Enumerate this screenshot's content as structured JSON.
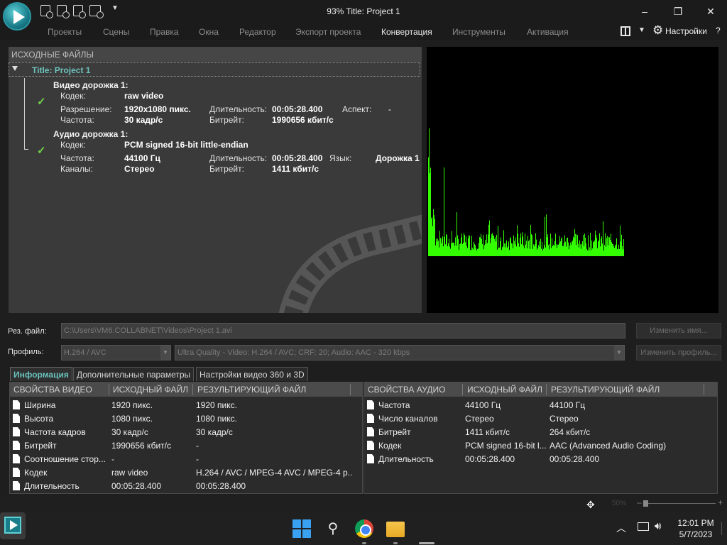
{
  "window": {
    "title": "93% Title: Project 1",
    "minimize": "–",
    "maximize": "❐",
    "close": "✕"
  },
  "menu": {
    "items": [
      "Проекты",
      "Сцены",
      "Правка",
      "Окна",
      "Редактор",
      "Экспорт проекта",
      "Конвертация",
      "Инструменты",
      "Активация"
    ],
    "active": "Конвертация",
    "settings_label": "Настройки",
    "help": "?"
  },
  "source": {
    "header": "ИСХОДНЫЕ ФАЙЛЫ",
    "project_title": "Title: Project 1",
    "video": {
      "title": "Видео дорожка 1:",
      "codec_label": "Кодек:",
      "codec": "raw video",
      "resolution_label": "Разрешение:",
      "resolution": "1920x1080 пикс.",
      "duration_label": "Длительность:",
      "duration": "00:05:28.400",
      "aspect_label": "Аспект:",
      "aspect": "-",
      "fps_label": "Частота:",
      "fps": "30 кадр/с",
      "bitrate_label": "Битрейт:",
      "bitrate": "1990656 кбит/с"
    },
    "audio": {
      "title": "Аудио дорожка 1:",
      "codec_label": "Кодек:",
      "codec": "PCM signed 16-bit little-endian",
      "rate_label": "Частота:",
      "rate": "44100 Гц",
      "duration_label": "Длительность:",
      "duration": "00:05:28.400",
      "lang_label": "Язык:",
      "lang": "Дорожка 1",
      "channels_label": "Каналы:",
      "channels": "Стерео",
      "bitrate_label": "Битрейт:",
      "bitrate": "1411 кбит/с"
    }
  },
  "output": {
    "file_label": "Рез. файл:",
    "file_path": "C:\\Users\\VM6.COLLABNET\\Videos\\Project 1.avi",
    "rename_button": "Изменить имя...",
    "profile_label": "Профиль:",
    "profile_format": "H.264 / AVC",
    "profile_preset": "Ultra Quality - Video: H.264 / AVC; CRF: 20; Audio: AAC - 320 kbps",
    "change_profile_button": "Изменить профиль..."
  },
  "tabs": [
    "Информация",
    "Дополнительные параметры",
    "Настройки видео 360 и 3D"
  ],
  "video_table": {
    "headers": [
      "СВОЙСТВА ВИДЕО",
      "ИСХОДНЫЙ ФАЙЛ",
      "РЕЗУЛЬТИРУЮЩИЙ ФАЙЛ"
    ],
    "rows": [
      [
        "Ширина",
        "1920 пикс.",
        "1920 пикс."
      ],
      [
        "Высота",
        "1080 пикс.",
        "1080 пикс."
      ],
      [
        "Частота кадров",
        "30 кадр/с",
        "30 кадр/с"
      ],
      [
        "Битрейт",
        "1990656 кбит/с",
        "-"
      ],
      [
        "Соотношение стор...",
        "-",
        "-"
      ],
      [
        "Кодек",
        "raw video",
        "H.264 / AVC / MPEG-4 AVC / MPEG-4 p..."
      ],
      [
        "Длительность",
        "00:05:28.400",
        "00:05:28.400"
      ]
    ]
  },
  "audio_table": {
    "headers": [
      "СВОЙСТВА АУДИО",
      "ИСХОДНЫЙ ФАЙЛ",
      "РЕЗУЛЬТИРУЮЩИЙ ФАЙЛ"
    ],
    "rows": [
      [
        "Частота",
        "44100 Гц",
        "44100 Гц"
      ],
      [
        "Число каналов",
        "Стерео",
        "Стерео"
      ],
      [
        "Битрейт",
        "1411 кбит/с",
        "264 кбит/с"
      ],
      [
        "Кодек",
        "PCM signed 16-bit l...",
        "AAC (Advanced Audio Coding)"
      ],
      [
        "Длительность",
        "00:05:28.400",
        "00:05:28.400"
      ]
    ]
  },
  "statusbar": {
    "zoom": "50%",
    "zoom_minus": "–",
    "zoom_plus": "+"
  },
  "taskbar": {
    "time": "12:01 PM",
    "date": "5/7/2023"
  },
  "colors": {
    "accent": "#69c0bb",
    "check": "#6fd24b",
    "spectrum": "#33ff00"
  }
}
